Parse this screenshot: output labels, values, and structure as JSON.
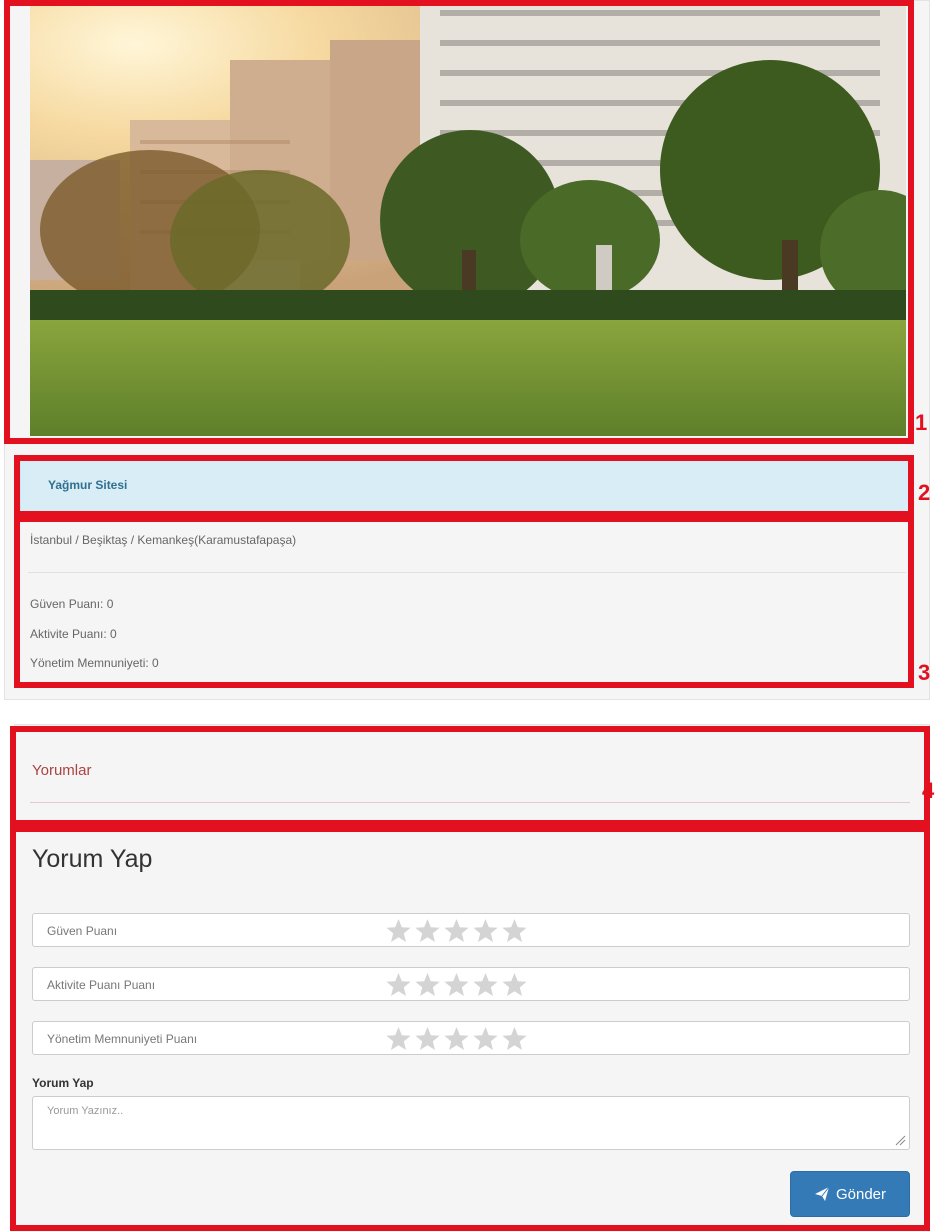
{
  "site": {
    "name": "Yağmur Sitesi",
    "location": "İstanbul / Beşiktaş / Kemankeş(Karamustafapaşa)",
    "scores": [
      {
        "label": "Güven Puanı: 0"
      },
      {
        "label": "Aktivite Puanı: 0"
      },
      {
        "label": "Yönetim Memnuniyeti: 0"
      }
    ]
  },
  "comments": {
    "title": "Yorumlar",
    "form_title": "Yorum Yap",
    "ratings": [
      {
        "label": "Güven Puanı",
        "stars": 0,
        "max": 5
      },
      {
        "label": "Aktivite Puanı Puanı",
        "stars": 0,
        "max": 5
      },
      {
        "label": "Yönetim Memnuniyeti Puanı",
        "stars": 0,
        "max": 5
      }
    ],
    "textarea_label": "Yorum Yap",
    "textarea_placeholder": "Yorum Yazınız..",
    "send_label": "Gönder"
  },
  "annotations": [
    "1",
    "2",
    "3",
    "4"
  ],
  "colors": {
    "annotation": "#e3101f",
    "title_bar": "#d9edf7",
    "button": "#337ab7",
    "comments_title": "#a94442",
    "star_empty": "#d4d4d4"
  },
  "icons": {
    "star": "star-icon",
    "send": "paper-plane-icon",
    "resize": "resize-handle-icon"
  }
}
